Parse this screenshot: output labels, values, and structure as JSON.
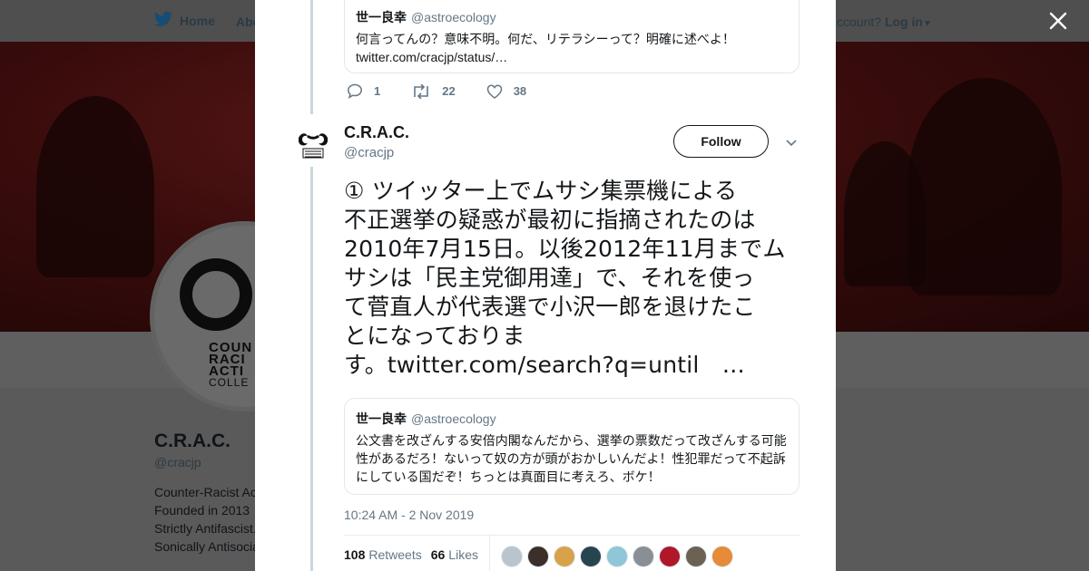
{
  "topbar": {
    "home_label": "Home",
    "about_label": "Abo",
    "account_text": "ccount?",
    "login_label": "Log in"
  },
  "profile": {
    "name": "C.R.A.C.",
    "handle": "@cracjp",
    "bio_lines": [
      "Counter-Racist Ac",
      "Founded in 2013",
      "Strictly Antifascist.",
      "Sonically Antisocia"
    ],
    "avatar_text": [
      "COUN",
      "RACI",
      "ACTI",
      "COLLE"
    ]
  },
  "prev_tweet": {
    "quote": {
      "name": "世一良幸",
      "handle": "@astroecology",
      "text_lines": [
        "何言ってんの？意味不明。何だ、リテラシーって？明確に述べよ！",
        "twitter.com/cracjp/status/…"
      ]
    },
    "actions": {
      "replies": "1",
      "retweets": "22",
      "likes": "38"
    }
  },
  "tweet": {
    "name": "C.R.A.C.",
    "handle": "@cracjp",
    "follow_label": "Follow",
    "text_lines": [
      "① ツイッター上でムサシ集票機による",
      "不正選挙の疑惑が最初に指摘されたのは",
      "2010年7月15日。以後2012年11月までム",
      "サシは「民主党御用達」で、それを使っ",
      "て菅直人が代表選で小沢一郎を退けたこ",
      "とになっておりま",
      "す。twitter.com/search?q=until　…"
    ],
    "quote": {
      "name": "世一良幸",
      "handle": "@astroecology",
      "text_lines": [
        "公文書を改ざんする安倍内閣なんだから、選挙の票数だって改ざんする可能",
        "性があるだろ！ないって奴の方が頭がおかしいんだよ！性犯罪だって不起訴",
        "にしている国だぞ！ちっとは真面目に考えろ、ボケ！"
      ]
    },
    "timestamp": "10:24 AM - 2 Nov 2019",
    "stats": {
      "retweets_count": "108",
      "retweets_label": "Retweets",
      "likes_count": "66",
      "likes_label": "Likes"
    },
    "liker_colors": [
      "#b9c4cc",
      "#3b2f2a",
      "#d8a24a",
      "#27454f",
      "#8fc6d8",
      "#8a8f96",
      "#b0182a",
      "#6b6253",
      "#e58b3a"
    ]
  },
  "colors": {
    "accent": "#1da1f2",
    "text": "#14171a",
    "muted": "#657786"
  }
}
